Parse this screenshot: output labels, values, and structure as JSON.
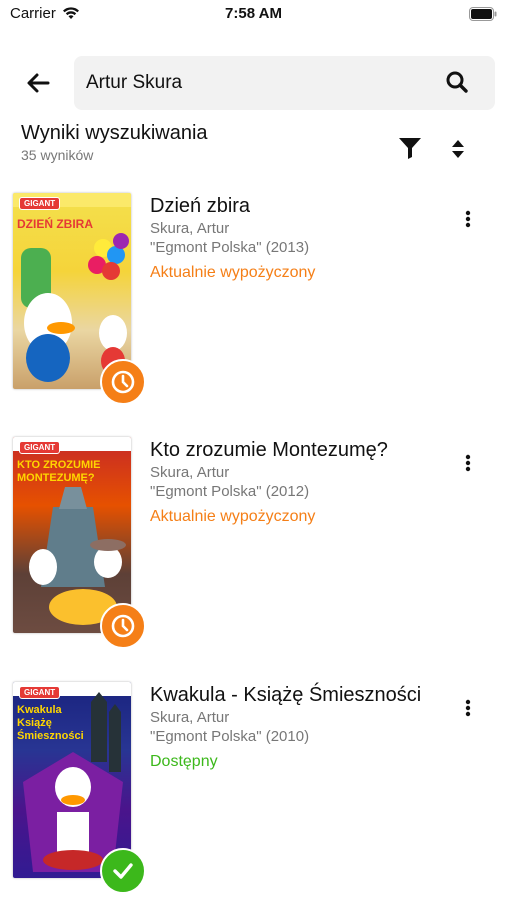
{
  "status_bar": {
    "carrier": "Carrier",
    "time": "7:58 AM"
  },
  "search": {
    "value": "Artur Skura",
    "placeholder": ""
  },
  "results": {
    "title": "Wyniki wyszukiwania",
    "count_text": "35 wyników"
  },
  "colors": {
    "orange": "#f57f17",
    "green": "#3cb81b"
  },
  "items": [
    {
      "title": "Dzień zbira",
      "author": "Skura, Artur",
      "publisher": "\"Egmont Polska\" (2013)",
      "status": "Aktualnie wypożyczony",
      "status_type": "borrowed",
      "cover_text": "DZIEŃ ZBIRA",
      "cover_logo": "GIGANT"
    },
    {
      "title": "Kto zrozumie Montezumę?",
      "author": "Skura, Artur",
      "publisher": "\"Egmont Polska\" (2012)",
      "status": "Aktualnie wypożyczony",
      "status_type": "borrowed",
      "cover_text": "KTO ZROZUMIE MONTEZUMĘ?",
      "cover_logo": "GIGANT"
    },
    {
      "title": "Kwakula - Książę Śmieszności",
      "author": "Skura, Artur",
      "publisher": "\"Egmont Polska\" (2010)",
      "status": "Dostępny",
      "status_type": "available",
      "cover_text": "Kwakula Książę Śmieszności",
      "cover_logo": "GIGANT"
    }
  ]
}
